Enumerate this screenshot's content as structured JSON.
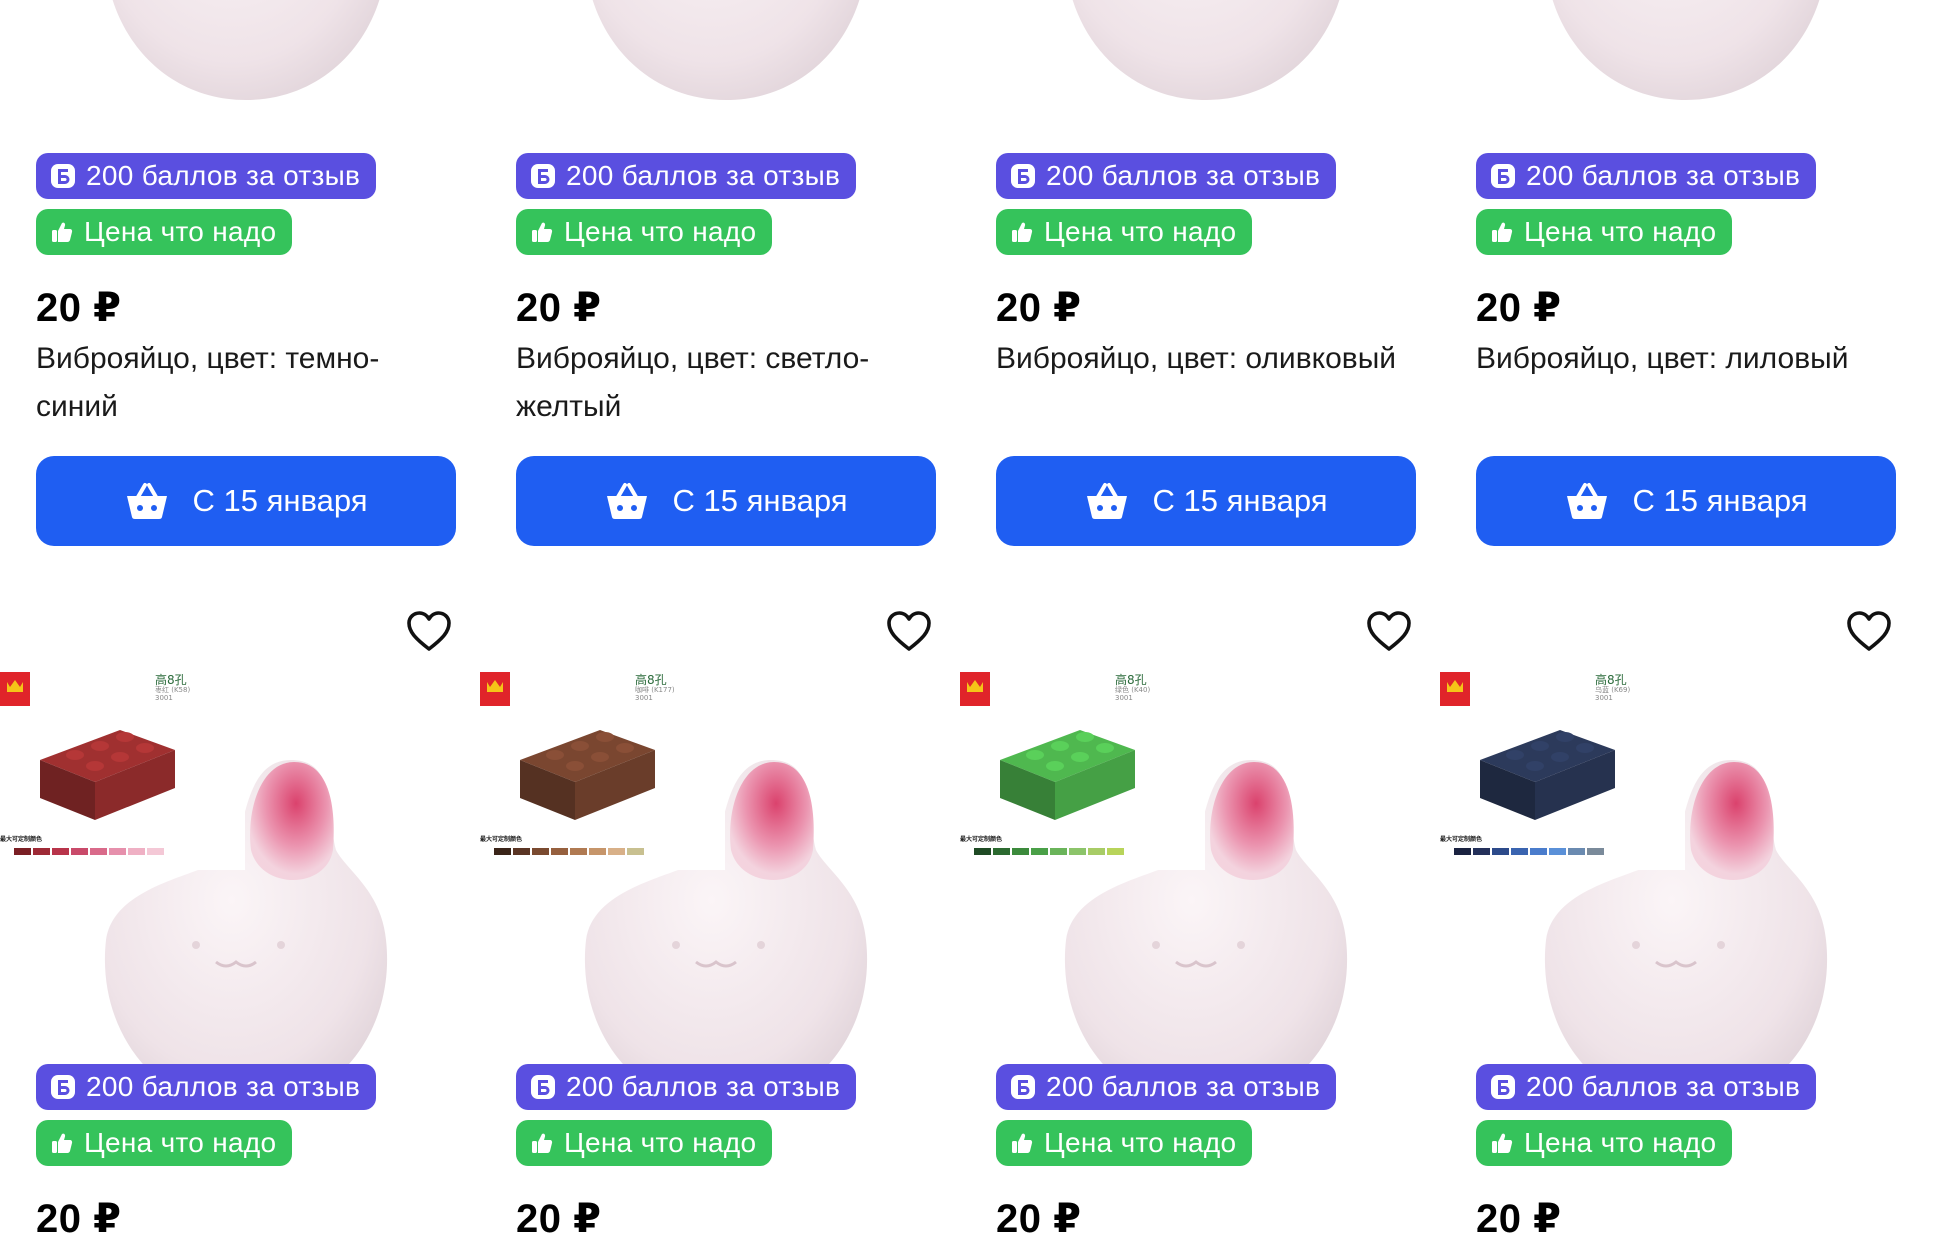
{
  "row1": [
    {
      "points_badge": "200 баллов за отзыв",
      "price_badge": "Цена что надо",
      "price": "20 ₽",
      "title": "Виброяйцо, цвет: темно-синий",
      "button": "С 15 января"
    },
    {
      "points_badge": "200 баллов за отзыв",
      "price_badge": "Цена что надо",
      "price": "20 ₽",
      "title": "Виброяйцо, цвет: светло-желтый",
      "button": "С 15 января"
    },
    {
      "points_badge": "200 баллов за отзыв",
      "price_badge": "Цена что надо",
      "price": "20 ₽",
      "title": "Виброяйцо, цвет: оливковый",
      "button": "С 15 января"
    },
    {
      "points_badge": "200 баллов за отзыв",
      "price_badge": "Цена что надо",
      "price": "20 ₽",
      "title": "Виброяйцо, цвет: лиловый",
      "button": "С 15 января"
    }
  ],
  "row2": [
    {
      "brick_color": "#8b2a2a",
      "brick_heading": "高8孔",
      "brick_sub": "枣红 (K58)",
      "brick_code": "3001",
      "palette_label": "最大可定制颜色",
      "swatches": [
        "#7a1f24",
        "#9e2a36",
        "#b8344a",
        "#c94a6a",
        "#d96a8a",
        "#e690ac",
        "#efb0c4",
        "#f4c8d6"
      ],
      "points_badge": "200 баллов за отзыв",
      "price_badge": "Цена что надо",
      "price": "20 ₽"
    },
    {
      "brick_color": "#6a3d2a",
      "brick_heading": "高8孔",
      "brick_sub": "咖啡 (K177)",
      "brick_code": "3001",
      "palette_label": "最大可定制颜色",
      "swatches": [
        "#3a2418",
        "#5a3524",
        "#7a4a30",
        "#96603e",
        "#b07a52",
        "#c6956a",
        "#d8b088",
        "#c8c090"
      ],
      "points_badge": "200 баллов за отзыв",
      "price_badge": "Цена что надо",
      "price": "20 ₽"
    },
    {
      "brick_color": "#45a045",
      "brick_heading": "高8孔",
      "brick_sub": "绿色 (K40)",
      "brick_code": "3001",
      "palette_label": "最大可定制颜色",
      "swatches": [
        "#1f4a24",
        "#2c6a30",
        "#3c8a3c",
        "#4aa048",
        "#6ab45a",
        "#8cc46a",
        "#a8cc66",
        "#b8d45a"
      ],
      "points_badge": "200 баллов за отзыв",
      "price_badge": "Цена что надо",
      "price": "20 ₽"
    },
    {
      "brick_color": "#26324f",
      "brick_heading": "高8孔",
      "brick_sub": "乌蓝 (K69)",
      "brick_code": "3001",
      "palette_label": "最大可定制颜色",
      "swatches": [
        "#1a2240",
        "#24305a",
        "#2c4a8a",
        "#3a64b0",
        "#4a7ccc",
        "#5a90d8",
        "#6a8ab0",
        "#7a8a9a"
      ],
      "points_badge": "200 баллов за отзыв",
      "price_badge": "Цена что надо",
      "price": "20 ₽"
    }
  ],
  "colors": {
    "points": "#5a4fe0",
    "price_tag": "#35c35b",
    "button": "#1f5ef2",
    "egg_pink": "#e0809c"
  },
  "icons": {
    "points": "points-b-icon",
    "price_tag": "thumbs-up-icon",
    "button": "basket-icon",
    "favorite": "heart-icon",
    "brand": "wange-crown-logo"
  }
}
